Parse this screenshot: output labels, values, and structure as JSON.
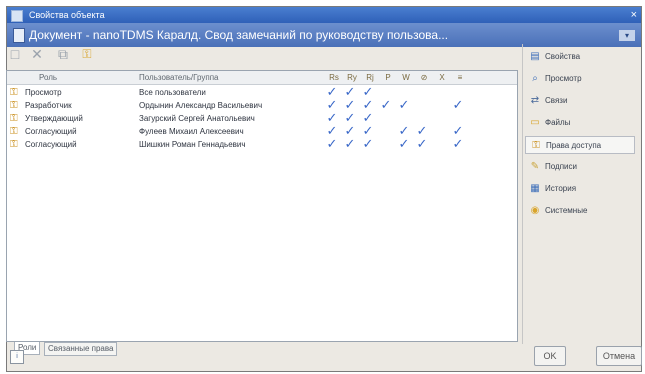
{
  "window": {
    "title": "Свойства объекта",
    "close_glyph": "×",
    "document_title": "Документ - nanoTDMS Каралд. Свод замечаний по руководству пользова...",
    "menu_arrow": "▾"
  },
  "toolbar": {
    "add_glyph": "□",
    "delete_glyph": "✕",
    "edit_glyph": "⧉",
    "key_glyph": "⚿"
  },
  "table": {
    "headers": {
      "role": "Роль",
      "user": "Пользователь/Группа"
    },
    "permission_glyphs": [
      "Rs",
      "Ry",
      "Rj",
      "P",
      "W",
      "⊘",
      "X",
      "≡"
    ],
    "rows": [
      {
        "role": "Просмотр",
        "user": "Все пользователи",
        "checks": [
          true,
          true,
          true,
          false,
          false,
          false,
          false,
          false
        ]
      },
      {
        "role": "Разработчик",
        "user": "Ордынин Александр Васильевич",
        "checks": [
          true,
          true,
          true,
          true,
          true,
          false,
          false,
          true
        ]
      },
      {
        "role": "Утверждающий",
        "user": "Загурский Сергей Анатольевич",
        "checks": [
          true,
          true,
          true,
          false,
          false,
          false,
          false,
          false
        ]
      },
      {
        "role": "Согласующий",
        "user": "Фулеев Михаил Алексеевич",
        "checks": [
          true,
          true,
          true,
          false,
          true,
          true,
          false,
          true
        ]
      },
      {
        "role": "Согласующий",
        "user": "Шишкин Роман Геннадьевич",
        "checks": [
          true,
          true,
          true,
          false,
          true,
          true,
          false,
          true
        ]
      }
    ]
  },
  "bottom_tabs": [
    "Роли",
    "Связанные права"
  ],
  "side_panel": {
    "items": [
      {
        "label": "Свойства",
        "icon": "properties-icon"
      },
      {
        "label": "Просмотр",
        "icon": "search-icon"
      },
      {
        "label": "Связи",
        "icon": "links-icon"
      },
      {
        "label": "Файлы",
        "icon": "files-icon"
      },
      {
        "label": "Права доступа",
        "icon": "key-icon"
      },
      {
        "label": "Подписи",
        "icon": "signature-icon"
      },
      {
        "label": "История",
        "icon": "history-icon"
      },
      {
        "label": "Системные",
        "icon": "system-icon"
      }
    ],
    "active_index": 4
  },
  "buttons": {
    "ok": "OK",
    "cancel": "Отмена"
  }
}
